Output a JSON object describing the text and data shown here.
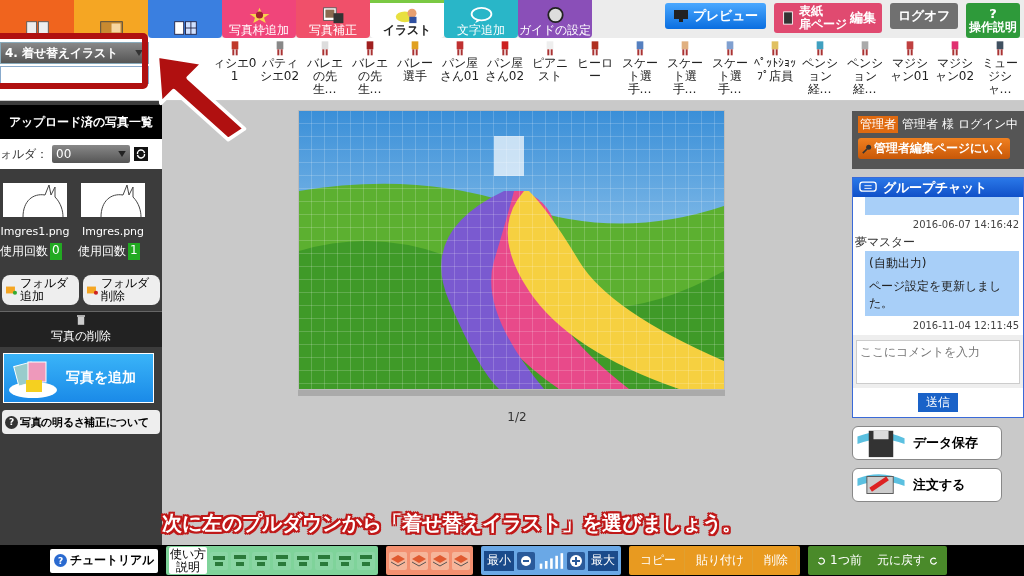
{
  "top_tabs": [
    {
      "kind": "spread",
      "color": "#f0641e",
      "selected": false
    },
    {
      "kind": "layout",
      "color": "#f5a623",
      "selected": false
    },
    {
      "kind": "grid",
      "color": "#3a7fe0",
      "selected": false
    },
    {
      "kind": "frame",
      "color": "#f0457a",
      "selected": false,
      "label": "写真枠追加"
    },
    {
      "kind": "photo",
      "color": "#f0506a",
      "selected": false,
      "label": "写真補正"
    },
    {
      "kind": "illust",
      "color": "#7ac943",
      "selected": true,
      "label": "イラスト"
    },
    {
      "kind": "text",
      "color": "#29b6c8",
      "selected": false,
      "label": "文字追加"
    },
    {
      "kind": "guide",
      "color": "#8a4fb8",
      "selected": false,
      "label": "ガイドの設定"
    }
  ],
  "top_buttons": {
    "preview": "プレビュー",
    "cover_lines": [
      "表紙",
      "扉ページ"
    ],
    "cover_action": "編集",
    "logoff": "ログオフ",
    "help_icon": "?",
    "help": "操作説明"
  },
  "category_select": {
    "value": "4. 着せ替えイラスト"
  },
  "illustrations": [
    {
      "label": "ィシエ01"
    },
    {
      "label": "パティシエ02"
    },
    {
      "label": "バレエの先生…"
    },
    {
      "label": "バレエの先生…"
    },
    {
      "label": "バレー選手"
    },
    {
      "label": "パン屋さん01"
    },
    {
      "label": "パン屋さん02"
    },
    {
      "label": "ピアニスト"
    },
    {
      "label": "ヒーロー"
    },
    {
      "label": "スケート選手…"
    },
    {
      "label": "スケート選手…"
    },
    {
      "label": "スケート選手…"
    },
    {
      "label": "ﾍﾟｯﾄｼｮｯﾌﾟ店員"
    },
    {
      "label": "ペンション経…"
    },
    {
      "label": "ペンション経…"
    },
    {
      "label": "マジシャン01"
    },
    {
      "label": "マジシャン02"
    },
    {
      "label": "ミュージシャ…"
    }
  ],
  "photos_panel": {
    "title": "アップロード済の写真一覧",
    "folder_label": "ォルダ：",
    "folder_value": "00",
    "photos": [
      {
        "name": "Imgres1.png",
        "usage_label": "使用回数",
        "usage_count": "0"
      },
      {
        "name": "Imgres.png",
        "usage_label": "使用回数",
        "usage_count": "1"
      }
    ],
    "add_folder": "フォルダ追加",
    "delete_folder": "フォルダ削除",
    "delete_photo": "写真の削除",
    "add_photo": "写真を追加",
    "brightness_icon": "?",
    "brightness_help": "写真の明るさ補正について"
  },
  "canvas": {
    "page": "1/2"
  },
  "admin": {
    "badge": "管理者",
    "status": "管理者 様 ログイン中",
    "link": "管理者編集ページにいく"
  },
  "chat": {
    "title": "グループチャット",
    "messages": [
      {
        "kind": "partial",
        "time": "2016-06-07 14:16:42"
      },
      {
        "kind": "full",
        "sender": "夢マスター",
        "lines": [
          "(自動出力)",
          "ページ設定を更新しました。"
        ],
        "time": "2016-11-04 12:11:45"
      }
    ],
    "placeholder": "ここにコメントを入力",
    "send": "送信"
  },
  "actions": {
    "save": "データ保存",
    "order": "注文する"
  },
  "caption": "次に左のプルダウンから「着せ替えイラスト」を選びましょう。",
  "bottom_toolbar": {
    "tutorial_icon": "?",
    "tutorial": "チュートリアル",
    "align_help": "使い方説明",
    "zoom_min": "最小",
    "zoom_max": "最大",
    "edit": [
      "コピー",
      "貼り付け",
      "削除"
    ],
    "undo": "1つ前",
    "revert": "元に戻す"
  }
}
